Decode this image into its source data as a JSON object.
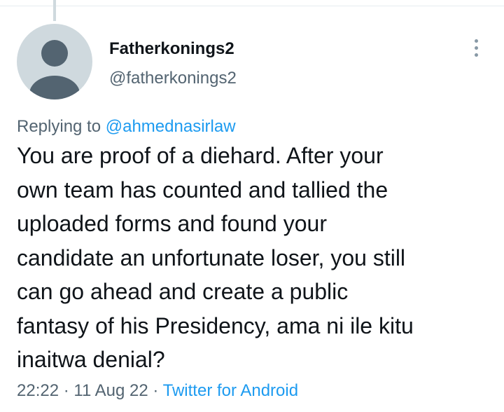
{
  "tweet": {
    "author": {
      "display_name": "Fatherkonings2",
      "handle": "@fatherkonings2"
    },
    "replying_to_prefix": "Replying to",
    "replying_to_handle": "@ahmednasirlaw",
    "text": "You are proof of a diehard. After your\nown team has counted and tallied the\nuploaded forms and found your\ncandidate an unfortunate loser, you still\ncan go ahead and create a public\nfantasy of his Presidency, ama ni ile kitu\ninaitwa denial?",
    "time": "22:22",
    "separator": "·",
    "date": "11 Aug 22",
    "source": "Twitter for Android"
  },
  "icons": {
    "avatar": "default-avatar-icon",
    "more": "more-vertical-icon"
  },
  "colors": {
    "text": "#0f1419",
    "secondary": "#536471",
    "link": "#1d9bf0",
    "avatar_bg": "#cfd9de",
    "avatar_figure": "#536471"
  }
}
